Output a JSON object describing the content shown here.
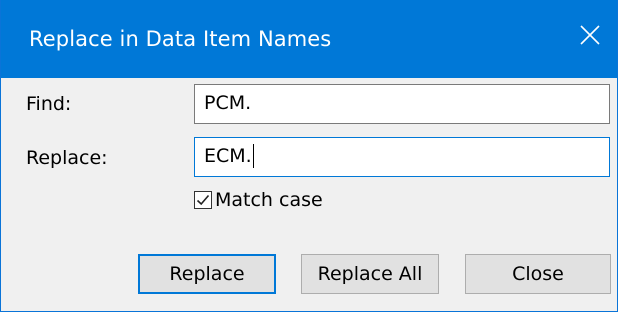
{
  "dialog": {
    "title": "Replace in Data Item Names",
    "close_icon": "close-icon",
    "accent_color": "#0078d7"
  },
  "find": {
    "label": "Find:",
    "value": "PCM."
  },
  "replace": {
    "label": "Replace:",
    "value": "ECM."
  },
  "match_case": {
    "label": "Match case",
    "checked": true
  },
  "buttons": {
    "replace_label": "Replace",
    "replace_all_label": "Replace All",
    "close_label": "Close"
  }
}
